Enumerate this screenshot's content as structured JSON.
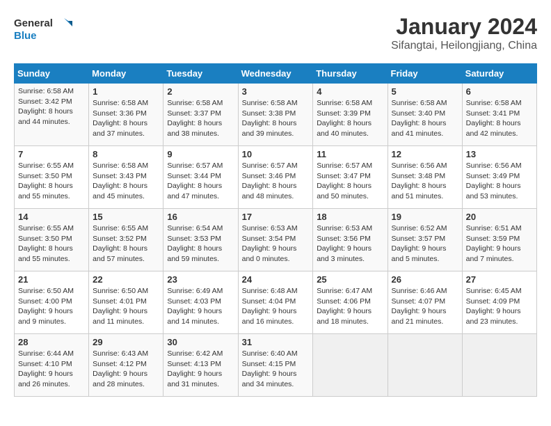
{
  "header": {
    "logo_line1": "General",
    "logo_line2": "Blue",
    "title": "January 2024",
    "subtitle": "Sifangtai, Heilongjiang, China"
  },
  "weekdays": [
    "Sunday",
    "Monday",
    "Tuesday",
    "Wednesday",
    "Thursday",
    "Friday",
    "Saturday"
  ],
  "weeks": [
    [
      {
        "day": "",
        "info": ""
      },
      {
        "day": "1",
        "info": "Sunrise: 6:58 AM\nSunset: 3:36 PM\nDaylight: 8 hours\nand 37 minutes."
      },
      {
        "day": "2",
        "info": "Sunrise: 6:58 AM\nSunset: 3:37 PM\nDaylight: 8 hours\nand 38 minutes."
      },
      {
        "day": "3",
        "info": "Sunrise: 6:58 AM\nSunset: 3:38 PM\nDaylight: 8 hours\nand 39 minutes."
      },
      {
        "day": "4",
        "info": "Sunrise: 6:58 AM\nSunset: 3:39 PM\nDaylight: 8 hours\nand 40 minutes."
      },
      {
        "day": "5",
        "info": "Sunrise: 6:58 AM\nSunset: 3:40 PM\nDaylight: 8 hours\nand 41 minutes."
      },
      {
        "day": "6",
        "info": "Sunrise: 6:58 AM\nSunset: 3:41 PM\nDaylight: 8 hours\nand 42 minutes."
      }
    ],
    [
      {
        "day": "7",
        "info": ""
      },
      {
        "day": "8",
        "info": "Sunrise: 6:58 AM\nSunset: 3:43 PM\nDaylight: 8 hours\nand 45 minutes."
      },
      {
        "day": "9",
        "info": "Sunrise: 6:57 AM\nSunset: 3:44 PM\nDaylight: 8 hours\nand 47 minutes."
      },
      {
        "day": "10",
        "info": "Sunrise: 6:57 AM\nSunset: 3:46 PM\nDaylight: 8 hours\nand 48 minutes."
      },
      {
        "day": "11",
        "info": "Sunrise: 6:57 AM\nSunset: 3:47 PM\nDaylight: 8 hours\nand 50 minutes."
      },
      {
        "day": "12",
        "info": "Sunrise: 6:56 AM\nSunset: 3:48 PM\nDaylight: 8 hours\nand 51 minutes."
      },
      {
        "day": "13",
        "info": "Sunrise: 6:56 AM\nSunset: 3:49 PM\nDaylight: 8 hours\nand 53 minutes."
      }
    ],
    [
      {
        "day": "14",
        "info": ""
      },
      {
        "day": "15",
        "info": "Sunrise: 6:55 AM\nSunset: 3:52 PM\nDaylight: 8 hours\nand 57 minutes."
      },
      {
        "day": "16",
        "info": "Sunrise: 6:54 AM\nSunset: 3:53 PM\nDaylight: 8 hours\nand 59 minutes."
      },
      {
        "day": "17",
        "info": "Sunrise: 6:53 AM\nSunset: 3:54 PM\nDaylight: 9 hours\nand 0 minutes."
      },
      {
        "day": "18",
        "info": "Sunrise: 6:53 AM\nSunset: 3:56 PM\nDaylight: 9 hours\nand 3 minutes."
      },
      {
        "day": "19",
        "info": "Sunrise: 6:52 AM\nSunset: 3:57 PM\nDaylight: 9 hours\nand 5 minutes."
      },
      {
        "day": "20",
        "info": "Sunrise: 6:51 AM\nSunset: 3:59 PM\nDaylight: 9 hours\nand 7 minutes."
      }
    ],
    [
      {
        "day": "21",
        "info": "Sunrise: 6:50 AM\nSunset: 4:00 PM\nDaylight: 9 hours\nand 9 minutes."
      },
      {
        "day": "22",
        "info": "Sunrise: 6:50 AM\nSunset: 4:01 PM\nDaylight: 9 hours\nand 11 minutes."
      },
      {
        "day": "23",
        "info": "Sunrise: 6:49 AM\nSunset: 4:03 PM\nDaylight: 9 hours\nand 14 minutes."
      },
      {
        "day": "24",
        "info": "Sunrise: 6:48 AM\nSunset: 4:04 PM\nDaylight: 9 hours\nand 16 minutes."
      },
      {
        "day": "25",
        "info": "Sunrise: 6:47 AM\nSunset: 4:06 PM\nDaylight: 9 hours\nand 18 minutes."
      },
      {
        "day": "26",
        "info": "Sunrise: 6:46 AM\nSunset: 4:07 PM\nDaylight: 9 hours\nand 21 minutes."
      },
      {
        "day": "27",
        "info": "Sunrise: 6:45 AM\nSunset: 4:09 PM\nDaylight: 9 hours\nand 23 minutes."
      }
    ],
    [
      {
        "day": "28",
        "info": "Sunrise: 6:44 AM\nSunset: 4:10 PM\nDaylight: 9 hours\nand 26 minutes."
      },
      {
        "day": "29",
        "info": "Sunrise: 6:43 AM\nSunset: 4:12 PM\nDaylight: 9 hours\nand 28 minutes."
      },
      {
        "day": "30",
        "info": "Sunrise: 6:42 AM\nSunset: 4:13 PM\nDaylight: 9 hours\nand 31 minutes."
      },
      {
        "day": "31",
        "info": "Sunrise: 6:40 AM\nSunset: 4:15 PM\nDaylight: 9 hours\nand 34 minutes."
      },
      {
        "day": "",
        "info": ""
      },
      {
        "day": "",
        "info": ""
      },
      {
        "day": "",
        "info": ""
      }
    ]
  ],
  "week1_sun_info": "Sunrise: 6:58 AM\nSunset: 3:42 PM\nDaylight: 8 hours\nand 44 minutes.",
  "week2_sun_info": "Sunrise: 6:55 AM\nSunset: 3:50 PM\nDaylight: 8 hours\nand 55 minutes."
}
